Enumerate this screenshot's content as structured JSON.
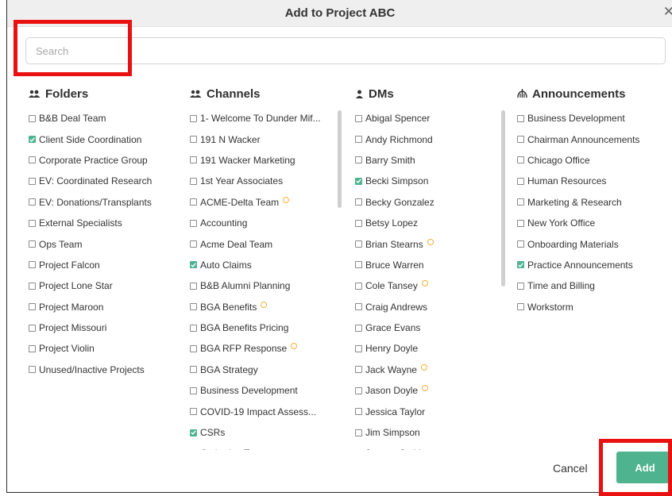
{
  "dialog": {
    "title": "Add to Project ABC",
    "close_glyph": "✕"
  },
  "search": {
    "placeholder": "Search",
    "value": ""
  },
  "colors": {
    "accent": "#4fb38f",
    "badge": "#f0b13a",
    "highlight": "#e81010"
  },
  "folders": {
    "header": "Folders",
    "icon": "people-icon",
    "items": [
      {
        "label": "B&B Deal Team",
        "checked": false,
        "badge": false
      },
      {
        "label": "Client Side Coordination",
        "checked": true,
        "badge": false
      },
      {
        "label": "Corporate Practice Group",
        "checked": false,
        "badge": false
      },
      {
        "label": "EV: Coordinated Research",
        "checked": false,
        "badge": false
      },
      {
        "label": "EV: Donations/Transplants",
        "checked": false,
        "badge": false
      },
      {
        "label": "External Specialists",
        "checked": false,
        "badge": false
      },
      {
        "label": "Ops Team",
        "checked": false,
        "badge": false
      },
      {
        "label": "Project Falcon",
        "checked": false,
        "badge": false
      },
      {
        "label": "Project Lone Star",
        "checked": false,
        "badge": false
      },
      {
        "label": "Project Maroon",
        "checked": false,
        "badge": false
      },
      {
        "label": "Project Missouri",
        "checked": false,
        "badge": false
      },
      {
        "label": "Project Violin",
        "checked": false,
        "badge": false
      },
      {
        "label": "Unused/Inactive Projects",
        "checked": false,
        "badge": false
      }
    ]
  },
  "channels": {
    "header": "Channels",
    "icon": "people-icon",
    "items": [
      {
        "label": "1- Welcome To Dunder Mif...",
        "checked": false,
        "badge": false
      },
      {
        "label": "191 N Wacker",
        "checked": false,
        "badge": false
      },
      {
        "label": "191 Wacker Marketing",
        "checked": false,
        "badge": false
      },
      {
        "label": "1st Year Associates",
        "checked": false,
        "badge": false
      },
      {
        "label": "ACME-Delta Team",
        "checked": false,
        "badge": true
      },
      {
        "label": "Accounting",
        "checked": false,
        "badge": false
      },
      {
        "label": "Acme Deal Team",
        "checked": false,
        "badge": false
      },
      {
        "label": "Auto Claims",
        "checked": true,
        "badge": false
      },
      {
        "label": "B&B Alumni Planning",
        "checked": false,
        "badge": false
      },
      {
        "label": "BGA Benefits",
        "checked": false,
        "badge": true
      },
      {
        "label": "BGA Benefits Pricing",
        "checked": false,
        "badge": false
      },
      {
        "label": "BGA RFP Response",
        "checked": false,
        "badge": true
      },
      {
        "label": "BGA Strategy",
        "checked": false,
        "badge": false
      },
      {
        "label": "Business Development",
        "checked": false,
        "badge": false
      },
      {
        "label": "COVID-19 Impact Assess...",
        "checked": false,
        "badge": false
      },
      {
        "label": "CSRs",
        "checked": true,
        "badge": false
      },
      {
        "label": "Cathering Team",
        "checked": false,
        "badge": false
      }
    ]
  },
  "dms": {
    "header": "DMs",
    "icon": "person-icon",
    "items": [
      {
        "label": "Abigal Spencer",
        "checked": false,
        "badge": false
      },
      {
        "label": "Andy Richmond",
        "checked": false,
        "badge": false
      },
      {
        "label": "Barry Smith",
        "checked": false,
        "badge": false
      },
      {
        "label": "Becki Simpson",
        "checked": true,
        "badge": false
      },
      {
        "label": "Becky Gonzalez",
        "checked": false,
        "badge": false
      },
      {
        "label": "Betsy Lopez",
        "checked": false,
        "badge": false
      },
      {
        "label": "Brian Stearns",
        "checked": false,
        "badge": true
      },
      {
        "label": "Bruce Warren",
        "checked": false,
        "badge": false
      },
      {
        "label": "Cole Tansey",
        "checked": false,
        "badge": true
      },
      {
        "label": "Craig Andrews",
        "checked": false,
        "badge": false
      },
      {
        "label": "Grace Evans",
        "checked": false,
        "badge": false
      },
      {
        "label": "Henry Doyle",
        "checked": false,
        "badge": false
      },
      {
        "label": "Jack Wayne",
        "checked": false,
        "badge": true
      },
      {
        "label": "Jason Doyle",
        "checked": false,
        "badge": true
      },
      {
        "label": "Jessica Taylor",
        "checked": false,
        "badge": false
      },
      {
        "label": "Jim Simpson",
        "checked": false,
        "badge": false
      },
      {
        "label": "Joanna Smith",
        "checked": false,
        "badge": false
      }
    ]
  },
  "announcements": {
    "header": "Announcements",
    "icon": "broadcast-icon",
    "items": [
      {
        "label": "Business Development",
        "checked": false,
        "badge": false
      },
      {
        "label": "Chairman Announcements",
        "checked": false,
        "badge": false
      },
      {
        "label": "Chicago Office",
        "checked": false,
        "badge": false
      },
      {
        "label": "Human Resources",
        "checked": false,
        "badge": false
      },
      {
        "label": "Marketing & Research",
        "checked": false,
        "badge": false
      },
      {
        "label": "New York Office",
        "checked": false,
        "badge": false
      },
      {
        "label": "Onboarding Materials",
        "checked": false,
        "badge": false
      },
      {
        "label": "Practice Announcements",
        "checked": true,
        "badge": false
      },
      {
        "label": "Time and Billing",
        "checked": false,
        "badge": false
      },
      {
        "label": "Workstorm",
        "checked": false,
        "badge": false
      }
    ]
  },
  "footer": {
    "cancel_label": "Cancel",
    "add_label": "Add"
  }
}
